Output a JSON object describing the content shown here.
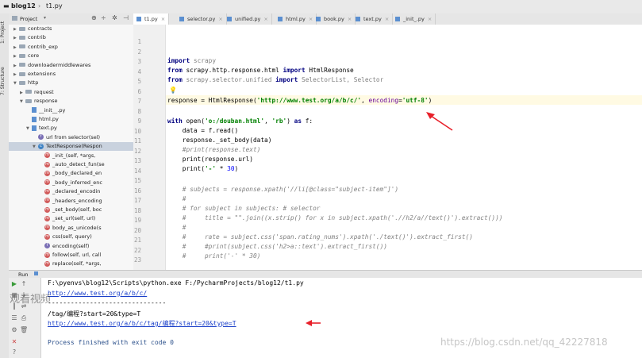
{
  "breadcrumb": {
    "project": "blog12",
    "file": "t1.py"
  },
  "tool_strip": {
    "project_tab": "1: Project",
    "structure_tab": "7: Structure"
  },
  "project_panel": {
    "title": "Project",
    "tree": [
      {
        "label": "contracts",
        "kind": "folder",
        "depth": 3,
        "expanded": false
      },
      {
        "label": "contrib",
        "kind": "folder",
        "depth": 3,
        "expanded": false
      },
      {
        "label": "contrib_exp",
        "kind": "folder",
        "depth": 3,
        "expanded": false
      },
      {
        "label": "core",
        "kind": "folder",
        "depth": 3,
        "expanded": false
      },
      {
        "label": "downloadermiddlewares",
        "kind": "folder",
        "depth": 3,
        "expanded": false
      },
      {
        "label": "extensions",
        "kind": "folder",
        "depth": 3,
        "expanded": false
      },
      {
        "label": "http",
        "kind": "folder",
        "depth": 3,
        "expanded": true
      },
      {
        "label": "request",
        "kind": "folder",
        "depth": 4,
        "expanded": false
      },
      {
        "label": "response",
        "kind": "folder",
        "depth": 4,
        "expanded": true
      },
      {
        "label": "__init__.py",
        "kind": "py",
        "depth": 5,
        "expanded": false
      },
      {
        "label": "html.py",
        "kind": "py",
        "depth": 5,
        "expanded": false
      },
      {
        "label": "text.py",
        "kind": "py",
        "depth": 5,
        "expanded": true
      },
      {
        "label": "url from selector(sel)",
        "kind": "fun",
        "depth": 6,
        "expanded": false
      },
      {
        "label": "TextResponse(Respon",
        "kind": "cls",
        "depth": 6,
        "expanded": true
      },
      {
        "label": "_init_(self, *args,",
        "kind": "mth",
        "depth": 7
      },
      {
        "label": "_auto_detect_fun(se",
        "kind": "mth",
        "depth": 7
      },
      {
        "label": "_body_declared_en",
        "kind": "mth",
        "depth": 7
      },
      {
        "label": "_body_inferred_enc",
        "kind": "mth",
        "depth": 7
      },
      {
        "label": "_declared_encodin",
        "kind": "mth",
        "depth": 7
      },
      {
        "label": "_headers_encoding",
        "kind": "mth",
        "depth": 7
      },
      {
        "label": "_set_body(self, boc",
        "kind": "mth",
        "depth": 7
      },
      {
        "label": "_set_url(self, url)",
        "kind": "mth",
        "depth": 7
      },
      {
        "label": "body_as_unicode(s",
        "kind": "mth",
        "depth": 7
      },
      {
        "label": "css(self, query)",
        "kind": "mth",
        "depth": 7
      },
      {
        "label": "encoding(self)",
        "kind": "fun",
        "depth": 7
      },
      {
        "label": "follow(self, url, call",
        "kind": "mth",
        "depth": 7
      },
      {
        "label": "replace(self, *args,",
        "kind": "mth",
        "depth": 7
      }
    ]
  },
  "editor_tabs": [
    {
      "label": "t1.py",
      "active": true
    },
    {
      "label": "selector.py",
      "active": false
    },
    {
      "label": "unified.py",
      "active": false
    },
    {
      "label": "html.py",
      "active": false
    },
    {
      "label": "book.py",
      "active": false
    },
    {
      "label": "text.py",
      "active": false
    },
    {
      "label": "_init_.py",
      "active": false
    }
  ],
  "editor": {
    "line_numbers": [
      "1",
      "2",
      "3",
      "4",
      "5",
      "6",
      "7",
      "8",
      "9",
      "10",
      "11",
      "12",
      "13",
      "14",
      "15",
      "16",
      "17",
      "18",
      "19",
      "20",
      "21",
      "22",
      "23"
    ]
  },
  "run_panel": {
    "title": "Run",
    "lines": [
      {
        "text": "F:\\pyenvs\\blog12\\Scripts\\python.exe F:/PycharmProjects/blog12/t1.py",
        "kind": "plain"
      },
      {
        "text": "http://www.test.org/a/b/c/",
        "kind": "link"
      },
      {
        "text": "-------------------------------",
        "kind": "plain"
      },
      {
        "text": "/tag/编程?start=20&type=T",
        "kind": "plain"
      },
      {
        "text": "http://www.test.org/a/b/c/tag/编程?start=20&type=T",
        "kind": "link"
      },
      {
        "text": "",
        "kind": "plain"
      },
      {
        "text": "Process finished with exit code 0",
        "kind": "proc"
      }
    ]
  },
  "watermark": {
    "text": "https://blog.csdn.net/qq_42227818",
    "overlay": "观看视频"
  },
  "colors": {
    "annotation_arrow": "#e8202a",
    "link": "#1a3fc9"
  }
}
